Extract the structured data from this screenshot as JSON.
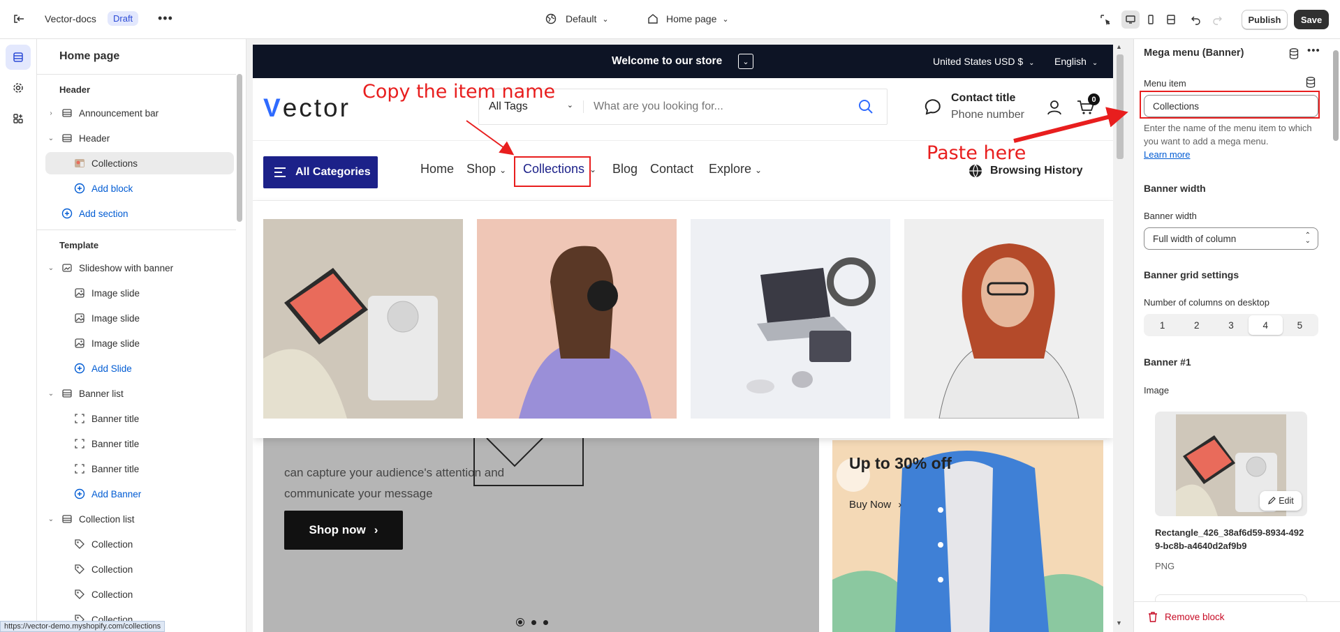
{
  "topbar": {
    "store_name": "Vector-docs",
    "badge": "Draft",
    "theme": "Default",
    "page": "Home page",
    "publish_label": "Publish",
    "save_label": "Save"
  },
  "sidebar": {
    "title": "Home page",
    "header_group": "Header",
    "header_items": [
      {
        "label": "Announcement bar",
        "icon": "section-icon"
      },
      {
        "label": "Header",
        "icon": "section-icon"
      },
      {
        "label": "Collections",
        "icon": "image-block-icon"
      },
      {
        "label": "Add block",
        "icon": "plus-circle-icon"
      },
      {
        "label": "Add section",
        "icon": "plus-circle-icon"
      }
    ],
    "template_group": "Template",
    "template_items": [
      {
        "label": "Slideshow with banner",
        "icon": "slideshow-icon"
      },
      {
        "label": "Image slide",
        "icon": "image-icon"
      },
      {
        "label": "Image slide",
        "icon": "image-icon"
      },
      {
        "label": "Image slide",
        "icon": "image-icon"
      },
      {
        "label": "Add Slide",
        "icon": "plus-circle-icon"
      },
      {
        "label": "Banner list",
        "icon": "section-icon"
      },
      {
        "label": "Banner title",
        "icon": "frame-icon"
      },
      {
        "label": "Banner title",
        "icon": "frame-icon"
      },
      {
        "label": "Banner title",
        "icon": "frame-icon"
      },
      {
        "label": "Add Banner",
        "icon": "plus-circle-icon"
      },
      {
        "label": "Collection list",
        "icon": "section-icon"
      },
      {
        "label": "Collection",
        "icon": "tag-icon"
      },
      {
        "label": "Collection",
        "icon": "tag-icon"
      },
      {
        "label": "Collection",
        "icon": "tag-icon"
      },
      {
        "label": "Collection",
        "icon": "tag-icon"
      }
    ]
  },
  "store": {
    "announcement": "Welcome to our store",
    "currency": "United States USD $",
    "language": "English",
    "logo_first": "V",
    "logo_rest": "ector",
    "search_category": "All Tags",
    "search_placeholder": "What are you looking for...",
    "contact_title": "Contact title",
    "phone": "Phone number",
    "cart_count": "0",
    "all_categories": "All Categories",
    "nav": [
      "Home",
      "Shop",
      "Collections",
      "Blog",
      "Contact",
      "Explore"
    ],
    "browsing_history": "Browsing History",
    "hero_line1": "can capture your audience's attention and",
    "hero_line2": "communicate your message",
    "shop_now": "Shop now",
    "promo_title": "Up to 30% off",
    "promo_cta": "Buy Now"
  },
  "panel": {
    "title": "Mega menu (Banner)",
    "menu_item_label": "Menu item",
    "menu_item_value": "Collections",
    "help_text": "Enter the name of the menu item to which you want to add a mega menu.",
    "learn_more": "Learn more",
    "banner_width_heading": "Banner width",
    "banner_width_label": "Banner width",
    "banner_width_value": "Full width of column",
    "grid_heading": "Banner grid settings",
    "columns_label": "Number of columns on desktop",
    "columns": [
      "1",
      "2",
      "3",
      "4",
      "5"
    ],
    "columns_selected": "4",
    "banner1_heading": "Banner #1",
    "image_label": "Image",
    "edit_label": "Edit",
    "file_name": "Rectangle_426_38af6d59-8934-4929-bc8b-a4640d2af9b9",
    "file_type": "PNG",
    "remove_block": "Remove block"
  },
  "annotations": {
    "copy_text": "Copy the item name",
    "paste_text": "Paste here",
    "color": "#e81e1e"
  },
  "status_url": "https://vector-demo.myshopify.com/collections"
}
